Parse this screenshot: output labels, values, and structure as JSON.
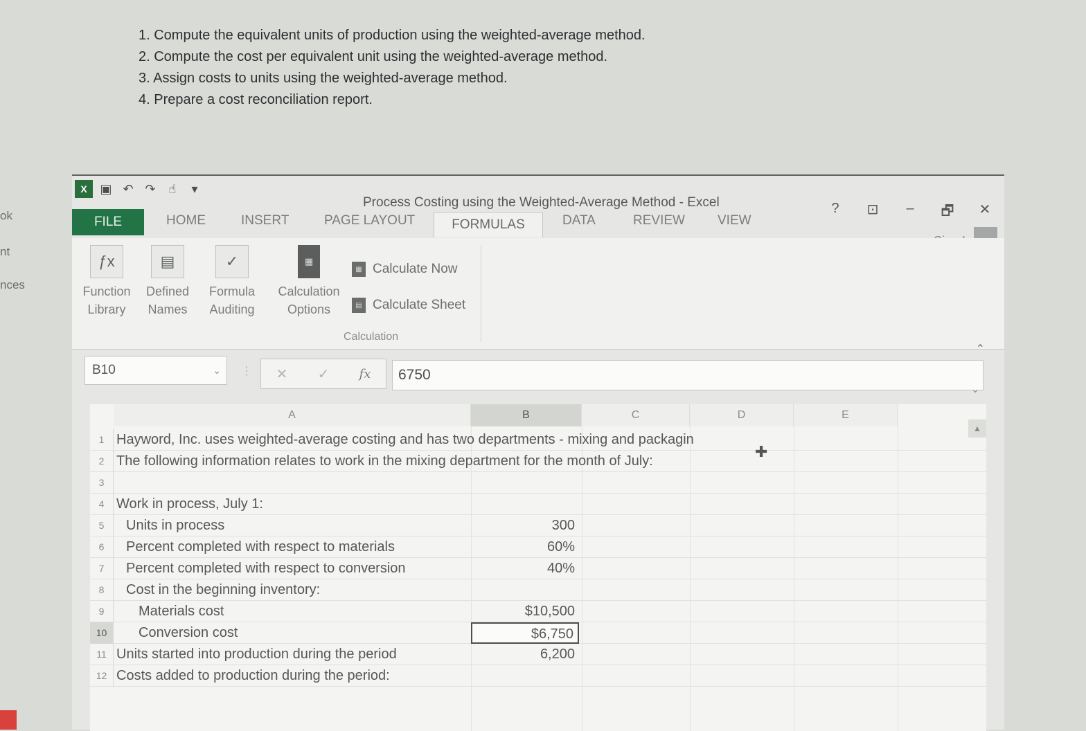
{
  "instructions": [
    "1. Compute the equivalent units of production using the weighted-average method.",
    "2. Compute the cost per equivalent unit using the weighted-average method.",
    "3. Assign costs to units using the weighted-average method.",
    "4. Prepare a cost reconciliation report."
  ],
  "left_strip": [
    "ok",
    "nt",
    "nces"
  ],
  "window": {
    "title": "Process Costing using the Weighted-Average Method - Excel",
    "help": "?",
    "minimize": "–",
    "restore": "🗗",
    "close": "✕",
    "sign_in": "Sign In"
  },
  "tabs": {
    "file": "FILE",
    "home": "HOME",
    "insert": "INSERT",
    "page_layout": "PAGE LAYOUT",
    "formulas": "FORMULAS",
    "data": "DATA",
    "review": "REVIEW",
    "view": "VIEW"
  },
  "ribbon": {
    "function_library": [
      "Function",
      "Library"
    ],
    "defined_names": [
      "Defined",
      "Names"
    ],
    "formula_auditing": [
      "Formula",
      "Auditing"
    ],
    "calculation_options": [
      "Calculation",
      "Options"
    ],
    "calculate_now": "Calculate Now",
    "calculate_sheet": "Calculate Sheet",
    "group_label": "Calculation"
  },
  "formula_bar": {
    "name_box": "B10",
    "value": "6750"
  },
  "columns": [
    "A",
    "B",
    "C",
    "D",
    "E"
  ],
  "rows": [
    {
      "n": "1",
      "a": "Hayword, Inc. uses weighted-average costing and has two departments - mixing and packagin",
      "b": "",
      "indent": 0
    },
    {
      "n": "2",
      "a": "The following information relates to work in the mixing department for the month of July:",
      "b": "",
      "indent": 0
    },
    {
      "n": "3",
      "a": "",
      "b": "",
      "indent": 0
    },
    {
      "n": "4",
      "a": "Work in process, July 1:",
      "b": "",
      "indent": 0
    },
    {
      "n": "5",
      "a": "Units in process",
      "b": "300",
      "indent": 1
    },
    {
      "n": "6",
      "a": "Percent completed with respect to materials",
      "b": "60%",
      "indent": 1
    },
    {
      "n": "7",
      "a": "Percent completed with respect to conversion",
      "b": "40%",
      "indent": 1
    },
    {
      "n": "8",
      "a": "Cost in the beginning inventory:",
      "b": "",
      "indent": 1
    },
    {
      "n": "9",
      "a": "Materials cost",
      "b": "$10,500",
      "indent": 2
    },
    {
      "n": "10",
      "a": "Conversion cost",
      "b": "$6,750",
      "indent": 2
    },
    {
      "n": "11",
      "a": "Units started into production during the period",
      "b": "6,200",
      "indent": 0
    },
    {
      "n": "12",
      "a": "Costs added to production during the period:",
      "b": "",
      "indent": 0
    }
  ],
  "selected_row": "10",
  "colors": {
    "excel_green": "#227447",
    "background": "#d9dbd7"
  }
}
